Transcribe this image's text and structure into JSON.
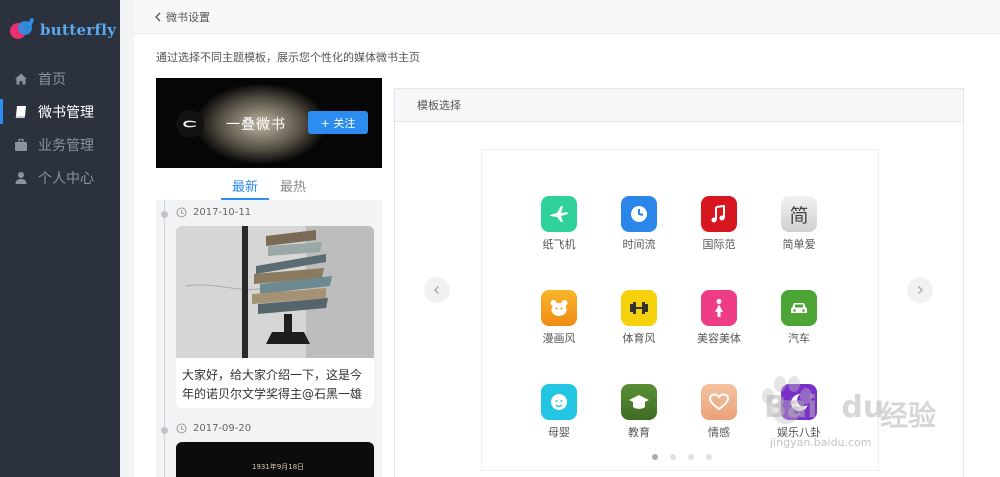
{
  "brand": {
    "name": "butterfly"
  },
  "nav": [
    {
      "label": "首页",
      "icon": "home-icon",
      "active": false
    },
    {
      "label": "微书管理",
      "icon": "book-icon",
      "active": true
    },
    {
      "label": "业务管理",
      "icon": "briefcase-icon",
      "active": false
    },
    {
      "label": "个人中心",
      "icon": "user-icon",
      "active": false
    }
  ],
  "breadcrumb": {
    "back_label": "微书设置"
  },
  "description": "通过选择不同主题模板，展示您个性化的媒体微书主页",
  "preview": {
    "banner_title": "一叠微书",
    "follow_label": "+ 关注",
    "tabs": [
      {
        "label": "最新",
        "active": true
      },
      {
        "label": "最热",
        "active": false
      }
    ],
    "posts": [
      {
        "date": "2017-10-11",
        "text": "大家好，给大家介绍一下，这是今年的诺贝尔文学奖得主@石黑一雄"
      },
      {
        "date": "2017-09-20",
        "image_text": "1931年9月18日"
      }
    ]
  },
  "panel": {
    "title": "模板选择",
    "templates": [
      {
        "label": "纸飞机",
        "icon": "airplane-icon",
        "color": "#2fd39a"
      },
      {
        "label": "时间流",
        "icon": "clock-icon",
        "color": "#2a86e8"
      },
      {
        "label": "国际范",
        "icon": "music-note-icon",
        "color": "#d7161f"
      },
      {
        "label": "简单爱",
        "icon": "jian-char-icon",
        "color": "#dcdcdc",
        "glyph": "简"
      },
      {
        "label": "漫画风",
        "icon": "bear-icon",
        "color": "#f6a01a"
      },
      {
        "label": "体育风",
        "icon": "dumbbell-icon",
        "color": "#f5d20b"
      },
      {
        "label": "美容美体",
        "icon": "woman-icon",
        "color": "#ee3d86"
      },
      {
        "label": "汽车",
        "icon": "car-icon",
        "color": "#4da535"
      },
      {
        "label": "母婴",
        "icon": "baby-icon",
        "color": "#22c6e3"
      },
      {
        "label": "教育",
        "icon": "graduation-cap-icon",
        "color": "#4d7d2e"
      },
      {
        "label": "情感",
        "icon": "heart-icon",
        "color": "#f0b48e"
      },
      {
        "label": "娱乐八卦",
        "icon": "moon-icon",
        "color": "#7a31c9"
      }
    ],
    "pages": 4,
    "active_page": 0
  },
  "watermark": {
    "text": "Bai",
    "text2": "du",
    "cn": "经验",
    "url": "jingyan.baidu.com"
  },
  "colors": {
    "accent": "#2d8cf0",
    "sidebar_bg": "#2b323d"
  }
}
